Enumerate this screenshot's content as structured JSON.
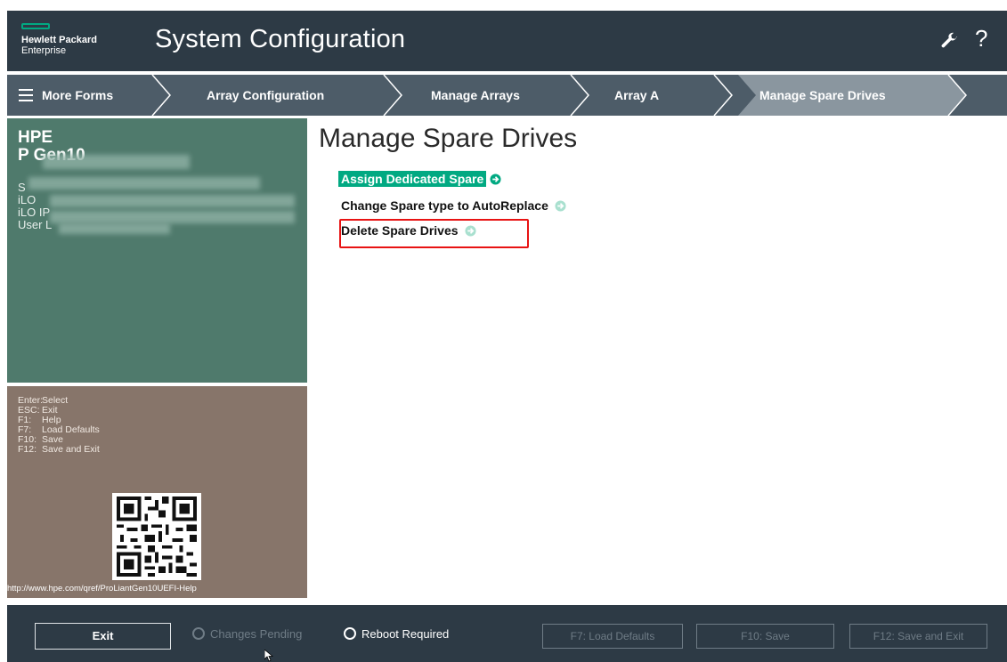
{
  "header": {
    "logo_line1": "Hewlett Packard",
    "logo_line2": "Enterprise",
    "title": "System Configuration",
    "wrench_icon": "wrench-icon",
    "help_glyph": "?"
  },
  "breadcrumb": {
    "menu_label": "More Forms",
    "items": [
      "Array Configuration",
      "Manage Arrays",
      "Array A",
      "Manage Spare Drives"
    ]
  },
  "system_info": {
    "model": "HPE\nP                 Gen10",
    "details": "S\niLO\niLO IP\nUser L"
  },
  "keys": [
    {
      "key": "Enter:",
      "action": "Select"
    },
    {
      "key": "ESC:",
      "action": "Exit"
    },
    {
      "key": "F1:",
      "action": "Help"
    },
    {
      "key": "F7:",
      "action": "Load Defaults"
    },
    {
      "key": "F10:",
      "action": "Save"
    },
    {
      "key": "F12:",
      "action": "Save and Exit"
    }
  ],
  "help_url": "http://www.hpe.com/qref/ProLiantGen10UEFI-Help",
  "main": {
    "title": "Manage Spare Drives",
    "options": [
      {
        "label": "Assign Dedicated Spare",
        "selected": true
      },
      {
        "label": "Change Spare type to AutoReplace",
        "selected": false
      },
      {
        "label": "Delete Spare Drives",
        "selected": false
      }
    ]
  },
  "footer": {
    "exit_label": "Exit",
    "changes_pending": "Changes Pending",
    "reboot_required": "Reboot Required",
    "f7_label": "F7: Load Defaults",
    "f10_label": "F10: Save",
    "f12_label": "F12: Save and Exit"
  },
  "colors": {
    "header_bg": "#2d3a45",
    "breadcrumb_bg": "#4d5c68",
    "breadcrumb_active": "#8a969f",
    "accent_green": "#01a982",
    "system_panel": "#4f7a6c",
    "keys_panel": "#87756a",
    "highlight_red": "#e81313"
  }
}
